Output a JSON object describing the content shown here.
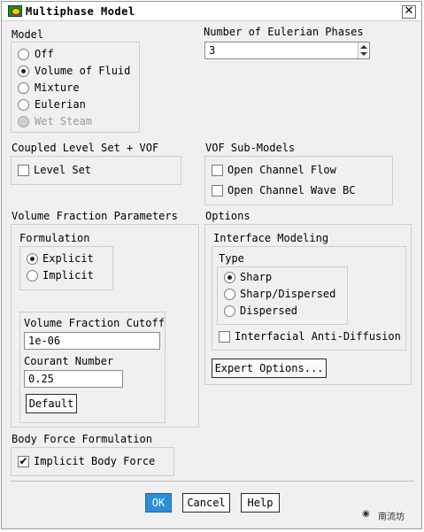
{
  "window": {
    "title": "Multiphase Model",
    "close_glyph": "✕"
  },
  "model": {
    "heading": "Model",
    "options": [
      "Off",
      "Volume of Fluid",
      "Mixture",
      "Eulerian",
      "Wet Steam"
    ],
    "selected": "Volume of Fluid"
  },
  "eulerian_phases": {
    "label": "Number of Eulerian Phases",
    "value": "3"
  },
  "coupled": {
    "heading": "Coupled Level Set + VOF",
    "level_set": "Level Set"
  },
  "vof_submodels": {
    "heading": "VOF Sub-Models",
    "open_channel_flow": "Open Channel Flow",
    "open_channel_wave_bc": "Open Channel Wave BC"
  },
  "vf_params": {
    "heading": "Volume Fraction Parameters",
    "formulation_heading": "Formulation",
    "explicit": "Explicit",
    "implicit": "Implicit",
    "cutoff_label": "Volume Fraction Cutoff",
    "cutoff_value": "1e-06",
    "courant_label": "Courant Number",
    "courant_value": "0.25",
    "default_button": "Default"
  },
  "options": {
    "heading": "Options",
    "interface_heading": "Interface Modeling",
    "type_heading": "Type",
    "sharp": "Sharp",
    "sharp_dispersed": "Sharp/Dispersed",
    "dispersed": "Dispersed",
    "anti_diffusion": "Interfacial Anti-Diffusion",
    "expert_button": "Expert Options..."
  },
  "body_force": {
    "heading": "Body Force Formulation",
    "implicit_body_force": "Implicit Body Force"
  },
  "buttons": {
    "ok": "OK",
    "cancel": "Cancel",
    "help": "Help"
  },
  "watermark": {
    "text": "南流坊"
  },
  "colors": {
    "primary_button": "#2b8fd6",
    "panel": "#f0f0f0"
  }
}
